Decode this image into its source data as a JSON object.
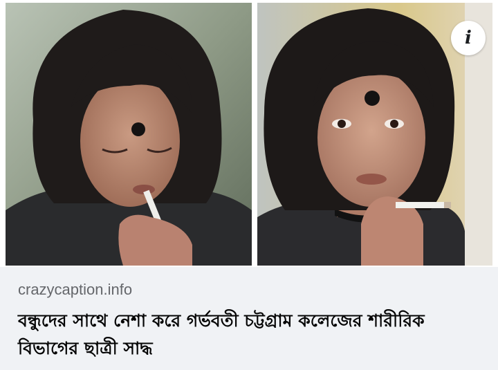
{
  "link_preview": {
    "domain": "crazycaption.info",
    "headline": "বন্ধুদের সাথে নেশা করে গর্ভবতী চট্টগ্রাম কলেজের শারীরিক বিভাগের ছাত্রী সাদ্ধ",
    "info_icon_glyph": "i"
  },
  "images": [
    {
      "name": "left-photo",
      "icon": "photo-woman-lighting-cigarette"
    },
    {
      "name": "right-photo",
      "icon": "photo-woman-holding-cigarette"
    }
  ],
  "colors": {
    "background": "#f0f2f5",
    "domain_text": "#65676b",
    "headline_text": "#050505"
  }
}
